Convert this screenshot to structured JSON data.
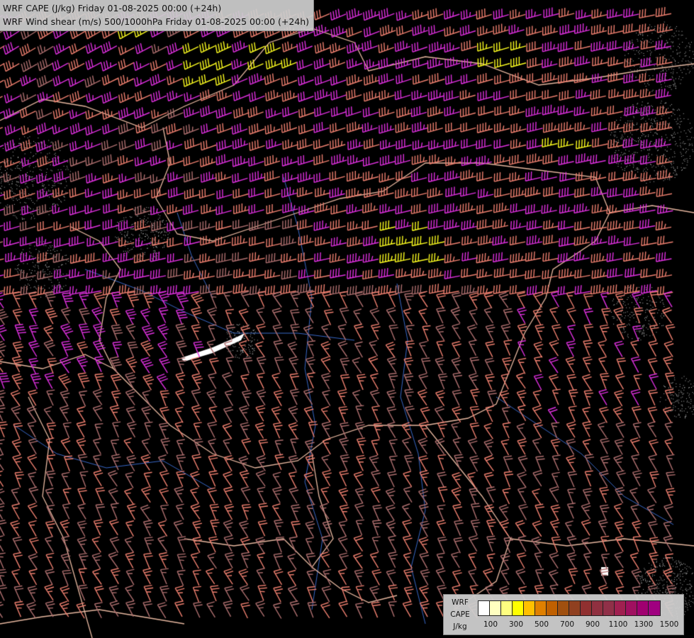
{
  "title": {
    "line1": "WRF CAPE (J/kg) Friday 01-08-2025 00:00 (+24h)",
    "line2": "WRF Wind shear (m/s) 500/1000hPa Friday 01-08-2025 00:00 (+24h)"
  },
  "legend": {
    "label_line1": "WRF",
    "label_line2": "CAPE",
    "label_unit": "J/kg",
    "colors": [
      "#ffffff",
      "#ffffc0",
      "#ffff80",
      "#ffff00",
      "#ffc000",
      "#e08000",
      "#c06000",
      "#a05010",
      "#904020",
      "#903030",
      "#903040",
      "#903048",
      "#a02050",
      "#a01060",
      "#a00070",
      "#a00080"
    ],
    "tick_labels": [
      "100",
      "300",
      "500",
      "700",
      "900",
      "1100",
      "1300",
      "1500"
    ]
  },
  "map": {
    "background": "#000000",
    "border_color": "#e8b8a0",
    "river_color": "#3868c8",
    "barb_colors": {
      "weak": "#b07070",
      "moderate": "#f08070",
      "strong": "#e030e0",
      "very_strong": "#ffff20"
    }
  }
}
